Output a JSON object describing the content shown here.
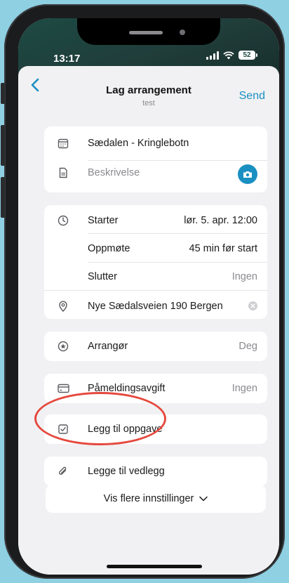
{
  "status": {
    "time": "13:17",
    "battery": "52"
  },
  "nav": {
    "title": "Lag arrangement",
    "subtitle": "test",
    "send_label": "Send"
  },
  "details": {
    "title_value": "Sædalen - Kringlebotn",
    "description_placeholder": "Beskrivelse"
  },
  "schedule": {
    "start_label": "Starter",
    "start_value": "lør. 5. apr.  12:00",
    "meet_label": "Oppmøte",
    "meet_value": "45 min før start",
    "end_label": "Slutter",
    "end_value": "Ingen",
    "location_value": "Nye Sædalsveien 190 Bergen"
  },
  "organizer": {
    "label": "Arrangør",
    "value": "Deg"
  },
  "fee": {
    "label": "Påmeldingsavgift",
    "value": "Ingen"
  },
  "task": {
    "label": "Legg til oppgave"
  },
  "attachment": {
    "label": "Legge til vedlegg"
  },
  "more_settings": {
    "label": "Vis flere innstillinger"
  },
  "colors": {
    "accent": "#1a8fc2",
    "highlight": "#e5483d",
    "status_bg": "#1d4a43"
  }
}
